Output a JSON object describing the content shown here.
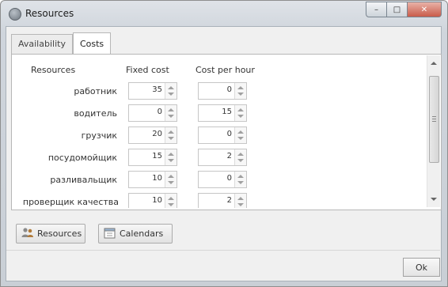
{
  "window": {
    "title": "Resources"
  },
  "tabs": [
    {
      "label": "Availability"
    },
    {
      "label": "Costs"
    }
  ],
  "table": {
    "headers": {
      "resources": "Resources",
      "fixed": "Fixed cost",
      "per_hour": "Cost per hour"
    },
    "rows": [
      {
        "name": "работник",
        "fixed": "35",
        "per_hour": "0"
      },
      {
        "name": "водитель",
        "fixed": "0",
        "per_hour": "15"
      },
      {
        "name": "грузчик",
        "fixed": "20",
        "per_hour": "0"
      },
      {
        "name": "посудомойщик",
        "fixed": "15",
        "per_hour": "2"
      },
      {
        "name": "разливальщик",
        "fixed": "10",
        "per_hour": "0"
      },
      {
        "name": "проверщик качества",
        "fixed": "10",
        "per_hour": "2"
      }
    ]
  },
  "buttons": {
    "resources": "Resources",
    "calendars": "Calendars",
    "ok": "Ok"
  },
  "icons": {
    "window": "app-icon",
    "resources": "users-icon",
    "calendars": "calendar-icon"
  }
}
